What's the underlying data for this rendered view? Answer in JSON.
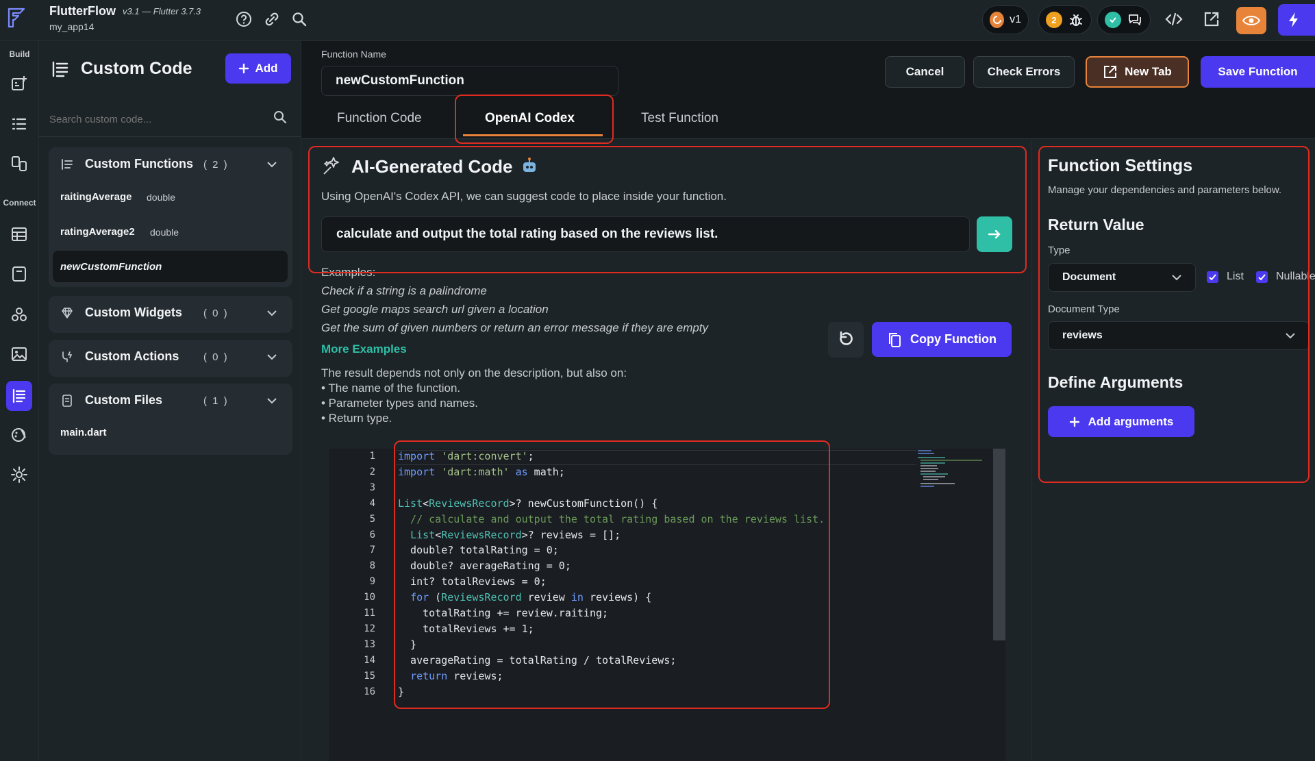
{
  "app": {
    "name": "FlutterFlow",
    "version": "v3.1 — Flutter 3.7.3",
    "project": "my_app14"
  },
  "topbar": {
    "version_pill": "v1",
    "bug_count": "2"
  },
  "rail": {
    "build_label": "Build",
    "connect_label": "Connect"
  },
  "sidebar": {
    "title": "Custom Code",
    "add_label": "Add",
    "search_placeholder": "Search custom code...",
    "sections": [
      {
        "title": "Custom Functions",
        "count": "( 2 )",
        "items": [
          {
            "name": "raitingAverage",
            "type": "double"
          },
          {
            "name": "ratingAverage2",
            "type": "double"
          },
          {
            "name": "newCustomFunction",
            "type": ""
          }
        ]
      },
      {
        "title": "Custom Widgets",
        "count": "( 0 )",
        "items": []
      },
      {
        "title": "Custom Actions",
        "count": "( 0 )",
        "items": []
      },
      {
        "title": "Custom Files",
        "count": "( 1 )",
        "items": [
          {
            "name": "main.dart",
            "type": ""
          }
        ]
      }
    ]
  },
  "header": {
    "function_name_label": "Function Name",
    "function_name_value": "newCustomFunction",
    "cancel_label": "Cancel",
    "check_errors_label": "Check Errors",
    "new_tab_label": "New Tab",
    "save_label": "Save Function"
  },
  "tabs": [
    {
      "label": "Function Code"
    },
    {
      "label": "OpenAI Codex"
    },
    {
      "label": "Test Function"
    }
  ],
  "codex": {
    "title": "AI-Generated Code",
    "description": "Using OpenAI's Codex API, we can suggest code to place inside your function.",
    "prompt_value": "calculate and output the total rating based on the reviews list.",
    "examples_title": "Examples:",
    "examples": [
      "Check if a string is a palindrome",
      "Get google maps search url given a location",
      "Get the sum of given numbers or return an error message if they are empty"
    ],
    "more_examples": "More Examples",
    "copy_label": "Copy Function",
    "note_intro": "The result depends not only on the description, but also on:",
    "notes": [
      "• The name of the function.",
      "• Parameter types and names.",
      "• Return type."
    ]
  },
  "code_lines": [
    "import 'dart:convert';",
    "import 'dart:math' as math;",
    "",
    "List<ReviewsRecord>? newCustomFunction() {",
    "  // calculate and output the total rating based on the reviews list.",
    "  List<ReviewsRecord>? reviews = [];",
    "  double? totalRating = 0;",
    "  double? averageRating = 0;",
    "  int? totalReviews = 0;",
    "  for (ReviewsRecord review in reviews) {",
    "    totalRating += review.raiting;",
    "    totalReviews += 1;",
    "  }",
    "  averageRating = totalRating / totalReviews;",
    "  return reviews;",
    "}"
  ],
  "settings": {
    "title": "Function Settings",
    "description": "Manage your dependencies and parameters below.",
    "return_title": "Return Value",
    "type_label": "Type",
    "type_value": "Document",
    "list_label": "List",
    "nullable_label": "Nullable",
    "doc_type_label": "Document Type",
    "doc_type_value": "reviews",
    "args_title": "Define Arguments",
    "add_args_label": "Add arguments"
  },
  "colors": {
    "accent": "#4b39ef",
    "teal": "#2fbfa6",
    "orange": "#e8833a",
    "highlight": "#e02b20"
  }
}
